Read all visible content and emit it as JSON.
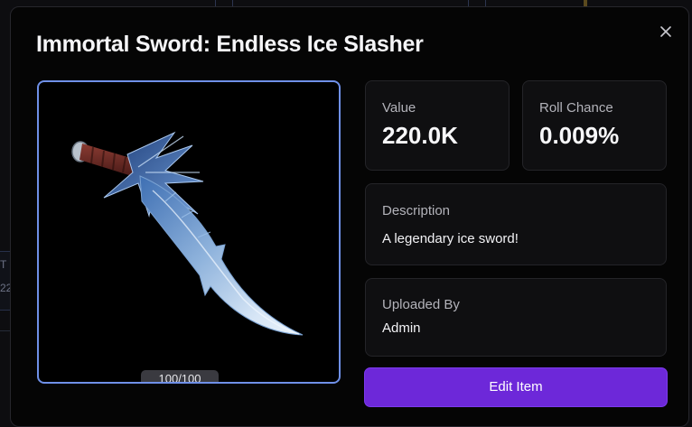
{
  "modal": {
    "title": "Immortal Sword: Endless Ice Slasher",
    "close_icon": "close-icon"
  },
  "item": {
    "image": "ice-sword-image",
    "stock": "100/100",
    "value_label": "Value",
    "value": "220.0K",
    "roll_chance_label": "Roll Chance",
    "roll_chance": "0.009%",
    "description_label": "Description",
    "description": "A legendary ice sword!",
    "uploaded_by_label": "Uploaded By",
    "uploaded_by": "Admin"
  },
  "actions": {
    "edit_label": "Edit Item"
  },
  "background": {
    "side_text_1": "T",
    "side_text_2": "22"
  },
  "colors": {
    "frame_border": "#6f90e8",
    "primary_button": "#6d28d9"
  }
}
